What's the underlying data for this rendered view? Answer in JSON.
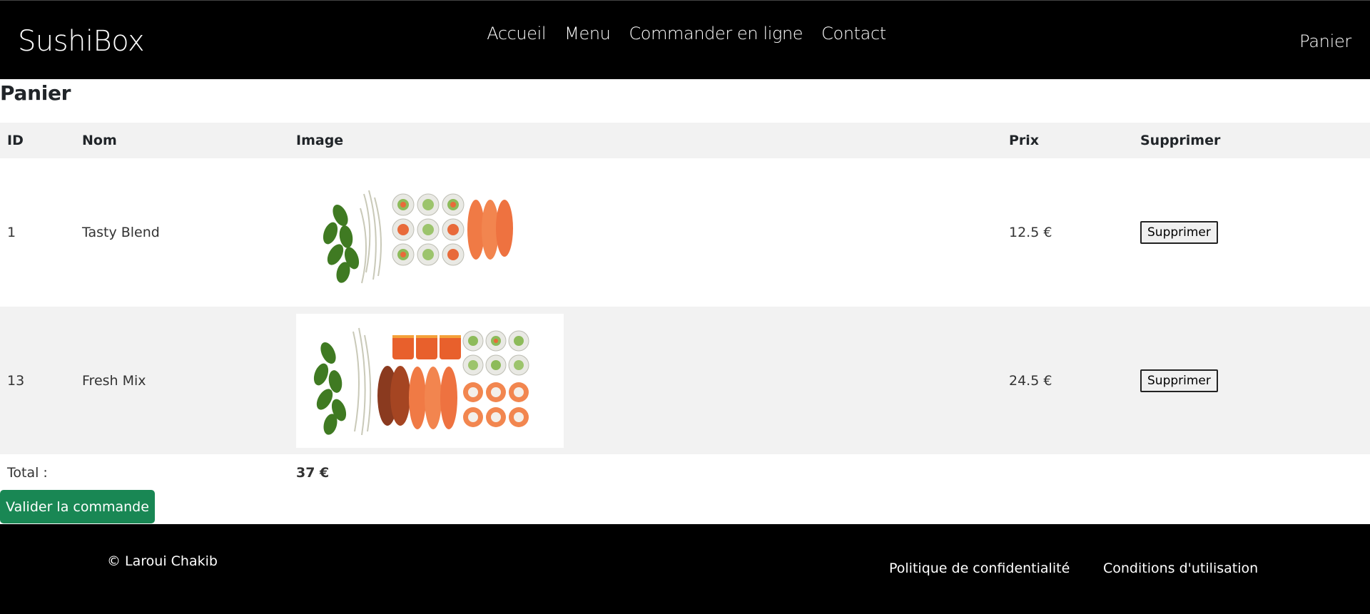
{
  "header": {
    "brand": "SushiBox",
    "nav": [
      {
        "label": "Accueil"
      },
      {
        "label": "Menu"
      },
      {
        "label": "Commander en ligne"
      },
      {
        "label": "Contact"
      }
    ],
    "cart_link": "Panier"
  },
  "page_title": "Panier",
  "table": {
    "headers": {
      "id": "ID",
      "nom": "Nom",
      "image": "Image",
      "prix": "Prix",
      "supprimer": "Supprimer"
    },
    "rows": [
      {
        "id": "1",
        "nom": "Tasty Blend",
        "image_alt": "Tasty Blend",
        "prix": "12.5 €",
        "delete_label": "Supprimer"
      },
      {
        "id": "13",
        "nom": "Fresh Mix",
        "image_alt": "Fresh Mix",
        "prix": "24.5 €",
        "delete_label": "Supprimer"
      }
    ],
    "total_label": "Total :",
    "total_value": "37 €"
  },
  "validate_button": "Valider la commande",
  "footer": {
    "copyright": "© Laroui Chakib",
    "links": [
      {
        "label": "Politique de confidentialité"
      },
      {
        "label": "Conditions d'utilisation"
      }
    ]
  },
  "colors": {
    "header_bg": "#000000",
    "footer_bg": "#000000",
    "validate_bg": "#198754",
    "row_alt_bg": "#f2f2f2"
  }
}
